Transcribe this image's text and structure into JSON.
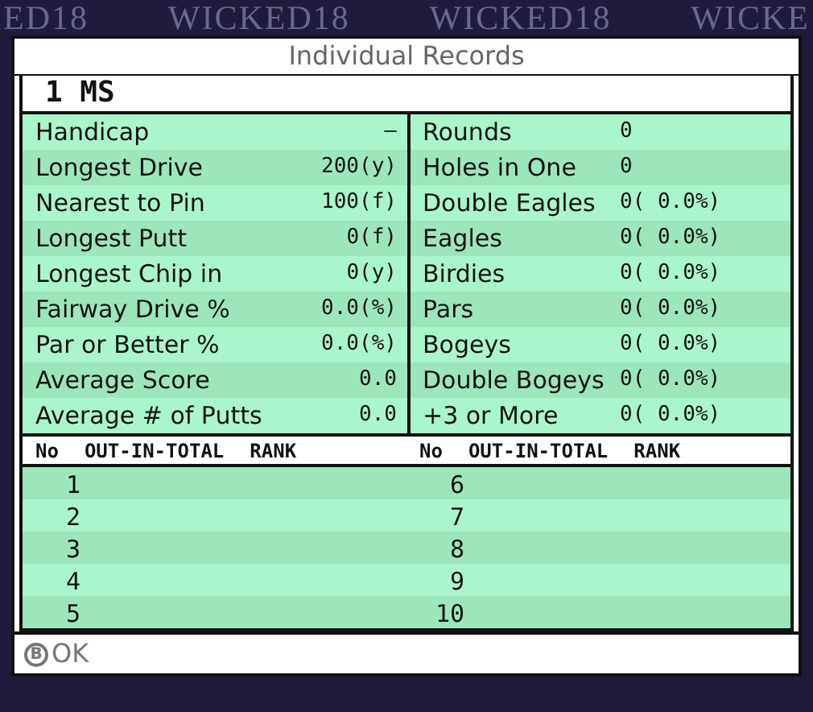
{
  "background_logos": [
    "ED18",
    "WICKED18",
    "WICKED18",
    "WICKE"
  ],
  "window": {
    "title": "Individual Records"
  },
  "player": "1 MS",
  "stats_left": [
    {
      "label": "Handicap",
      "value": "—"
    },
    {
      "label": "Longest Drive",
      "value": "200(y)"
    },
    {
      "label": "Nearest to Pin",
      "value": "100(f)"
    },
    {
      "label": "Longest Putt",
      "value": "0(f)"
    },
    {
      "label": "Longest Chip in",
      "value": "0(y)"
    },
    {
      "label": "Fairway Drive %",
      "value": "0.0(%)"
    },
    {
      "label": "Par or Better %",
      "value": "0.0(%)"
    },
    {
      "label": "Average Score",
      "value": "0.0"
    },
    {
      "label": "Average # of Putts",
      "value": "0.0"
    }
  ],
  "stats_right": [
    {
      "label": "Rounds",
      "value": "0"
    },
    {
      "label": "Holes in One",
      "value": "0"
    },
    {
      "label": "Double Eagles",
      "value": "0( 0.0%)"
    },
    {
      "label": "Eagles",
      "value": "0( 0.0%)"
    },
    {
      "label": "Birdies",
      "value": "0( 0.0%)"
    },
    {
      "label": "Pars",
      "value": "0( 0.0%)"
    },
    {
      "label": "Bogeys",
      "value": "0( 0.0%)"
    },
    {
      "label": "Double Bogeys",
      "value": "0( 0.0%)"
    },
    {
      "label": "+3 or More",
      "value": "0( 0.0%)"
    }
  ],
  "rounds_table": {
    "columns": [
      "No",
      "OUT-IN-TOTAL",
      "RANK",
      "No",
      "OUT-IN-TOTAL",
      "RANK"
    ],
    "rows": [
      {
        "left_no": "1",
        "right_no": "6"
      },
      {
        "left_no": "2",
        "right_no": "7"
      },
      {
        "left_no": "3",
        "right_no": "8"
      },
      {
        "left_no": "4",
        "right_no": "9"
      },
      {
        "left_no": "5",
        "right_no": "10"
      }
    ]
  },
  "footer": {
    "button_icon": "B",
    "label": "OK"
  }
}
